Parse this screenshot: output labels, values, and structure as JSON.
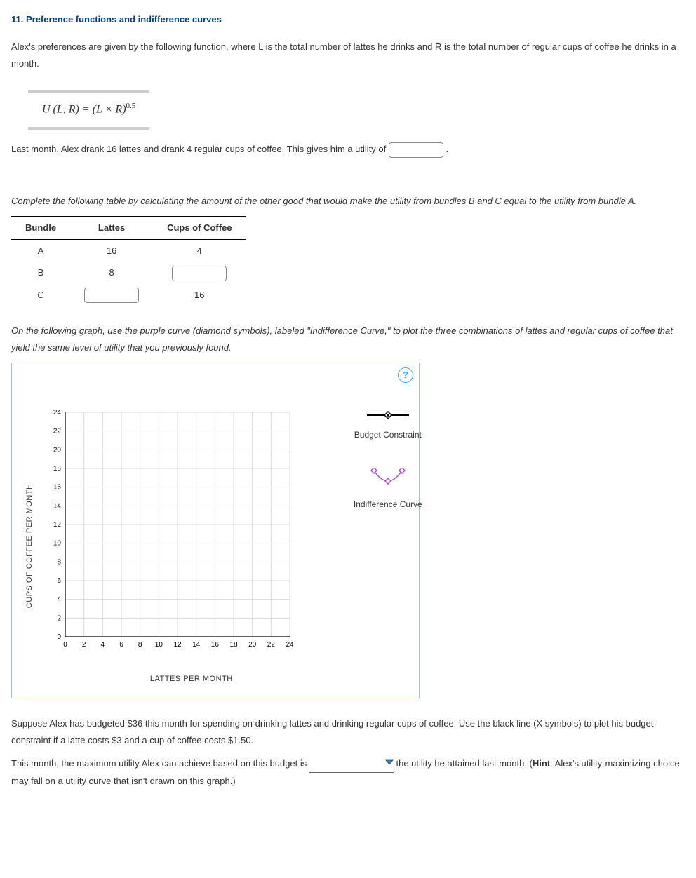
{
  "title": "11. Preference functions and indifference curves",
  "intro": "Alex's preferences are given by the following function, where L is the total number of lattes he drinks and R is the total number of regular cups of coffee he drinks in a month.",
  "formula_lhs": "U (L, R)",
  "formula_eq": " = ",
  "formula_rhs_base": "(L × R)",
  "formula_exp": "0.5",
  "sentence_a_pre": "Last month, Alex drank 16 lattes and drank 4 regular cups of coffee. This gives him a utility of ",
  "sentence_a_post": " .",
  "instr_table": "Complete the following table by calculating the amount of the other good that would make the utility from bundles B and C equal to the utility from bundle A.",
  "table": {
    "headers": [
      "Bundle",
      "Lattes",
      "Cups of Coffee"
    ],
    "rows": [
      {
        "bundle": "A",
        "lattes": "16",
        "coffee": "4",
        "lattes_input": false,
        "coffee_input": false
      },
      {
        "bundle": "B",
        "lattes": "8",
        "coffee": "",
        "lattes_input": false,
        "coffee_input": true
      },
      {
        "bundle": "C",
        "lattes": "",
        "coffee": "16",
        "lattes_input": true,
        "coffee_input": false
      }
    ]
  },
  "instr_graph": "On the following graph, use the purple curve (diamond symbols), labeled \"Indifference Curve,\" to plot the three combinations of lattes and regular cups of coffee that yield the same level of utility that you previously found.",
  "chart_data": {
    "type": "scatter",
    "title": "",
    "xlabel": "LATTES PER MONTH",
    "ylabel": "CUPS OF COFFEE PER MONTH",
    "x_ticks": [
      0,
      2,
      4,
      6,
      8,
      10,
      12,
      14,
      16,
      18,
      20,
      22,
      24
    ],
    "y_ticks": [
      0,
      2,
      4,
      6,
      8,
      10,
      12,
      14,
      16,
      18,
      20,
      22,
      24
    ],
    "xlim": [
      0,
      24
    ],
    "ylim": [
      0,
      24
    ],
    "series": []
  },
  "legend": {
    "item1": "Budget Constraint",
    "item2": "Indifference Curve"
  },
  "sentence_budget": "Suppose Alex has budgeted $36 this month for spending on drinking lattes and drinking regular cups of coffee. Use the black line (X symbols) to plot his budget constraint if a latte costs $3 and a cup of coffee costs $1.50.",
  "sentence_final_pre": "This month, the maximum utility Alex can achieve based on this budget is ",
  "sentence_final_mid": " the utility he attained last month. (",
  "sentence_final_hint_label": "Hint",
  "sentence_final_post": ": Alex's utility-maximizing choice may fall on a utility curve that isn't drawn on this graph.)",
  "input_values": {
    "utility": "",
    "b_coffee": "",
    "c_lattes": ""
  }
}
